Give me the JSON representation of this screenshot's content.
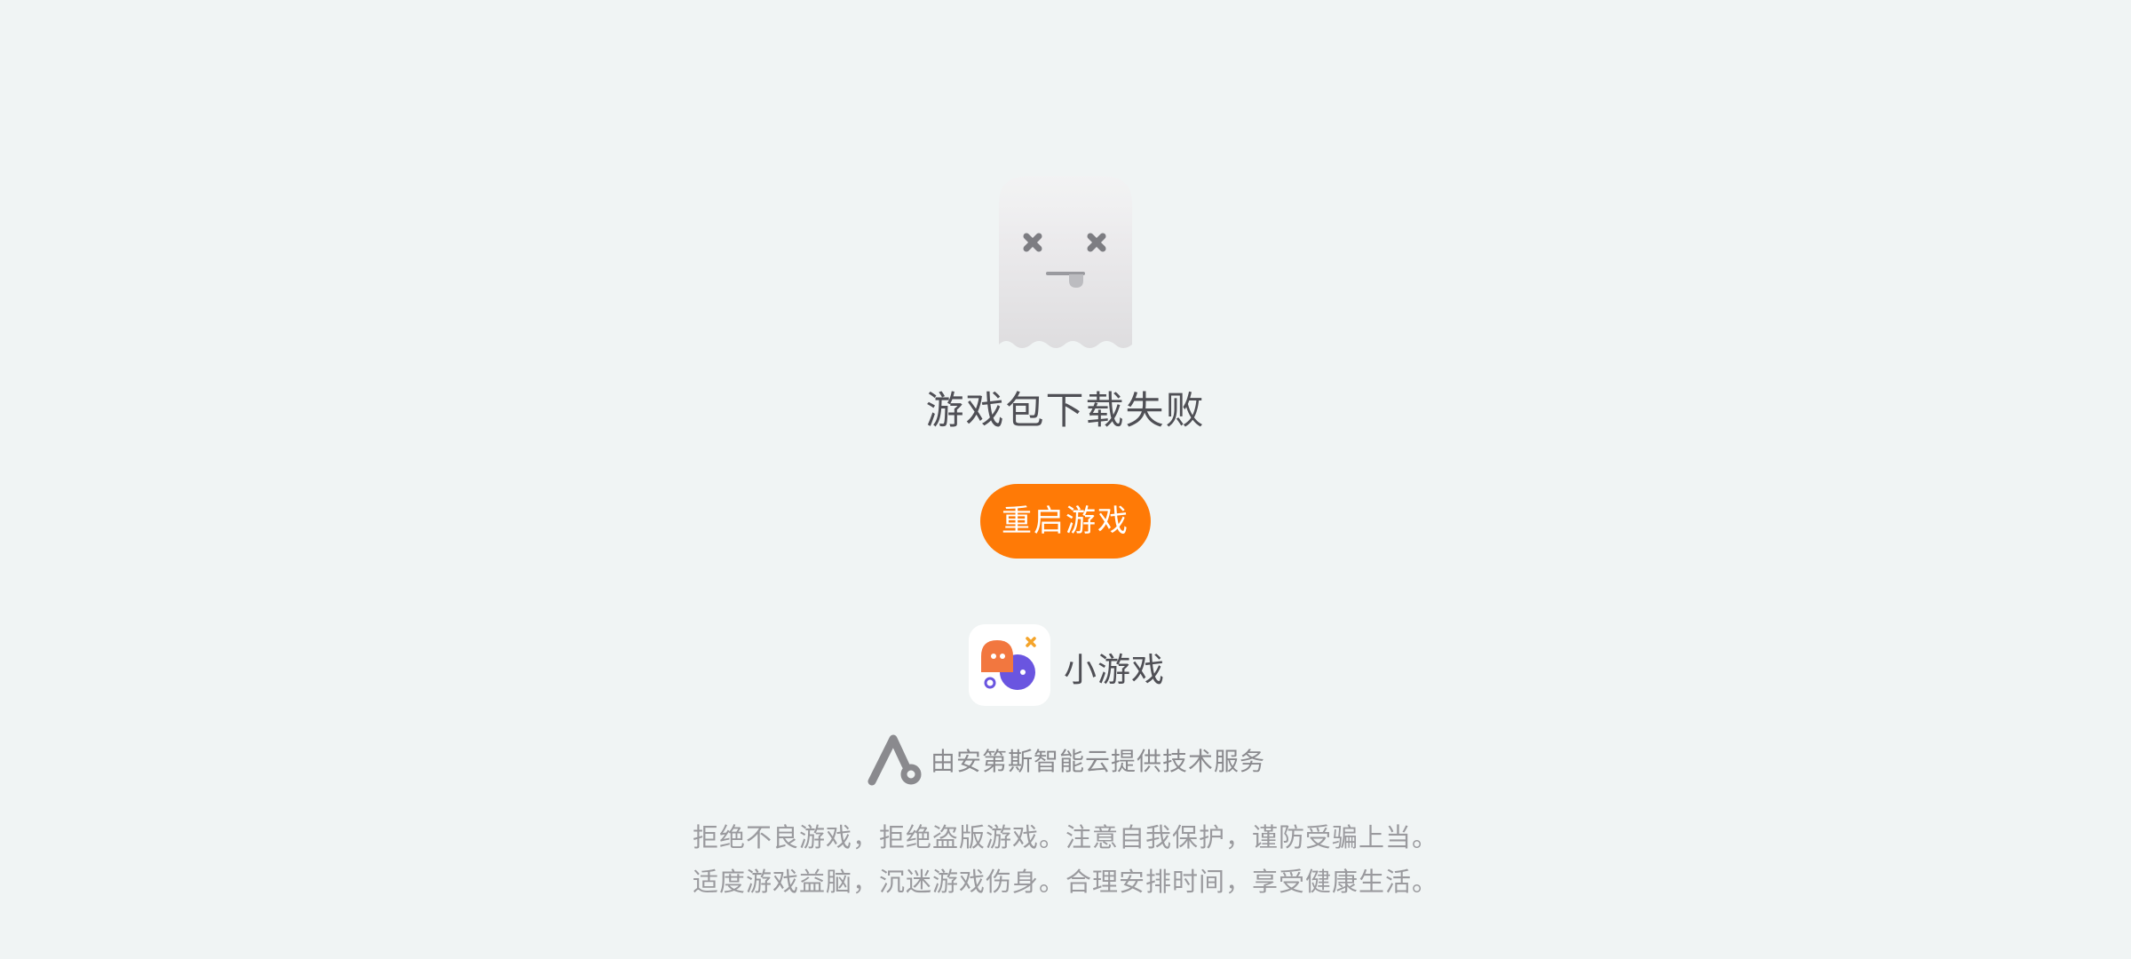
{
  "error": {
    "icon": "ghost-dead-icon",
    "message": "游戏包下载失败"
  },
  "actions": {
    "restart_label": "重启游戏"
  },
  "app": {
    "icon": "mini-game-app-icon",
    "name": "小游戏"
  },
  "provider": {
    "logo": "androidcloud-logo-icon",
    "text": "由安第斯智能云提供技术服务"
  },
  "notice": {
    "line1": "拒绝不良游戏，拒绝盗版游戏。注意自我保护，谨防受骗上当。",
    "line2": "适度游戏益脑，沉迷游戏伤身。合理安排时间，享受健康生活。"
  },
  "colors": {
    "background": "#f0f4f4",
    "accent": "#ff7a06",
    "app_orange": "#f2773f",
    "app_purple": "#6a55e0"
  }
}
